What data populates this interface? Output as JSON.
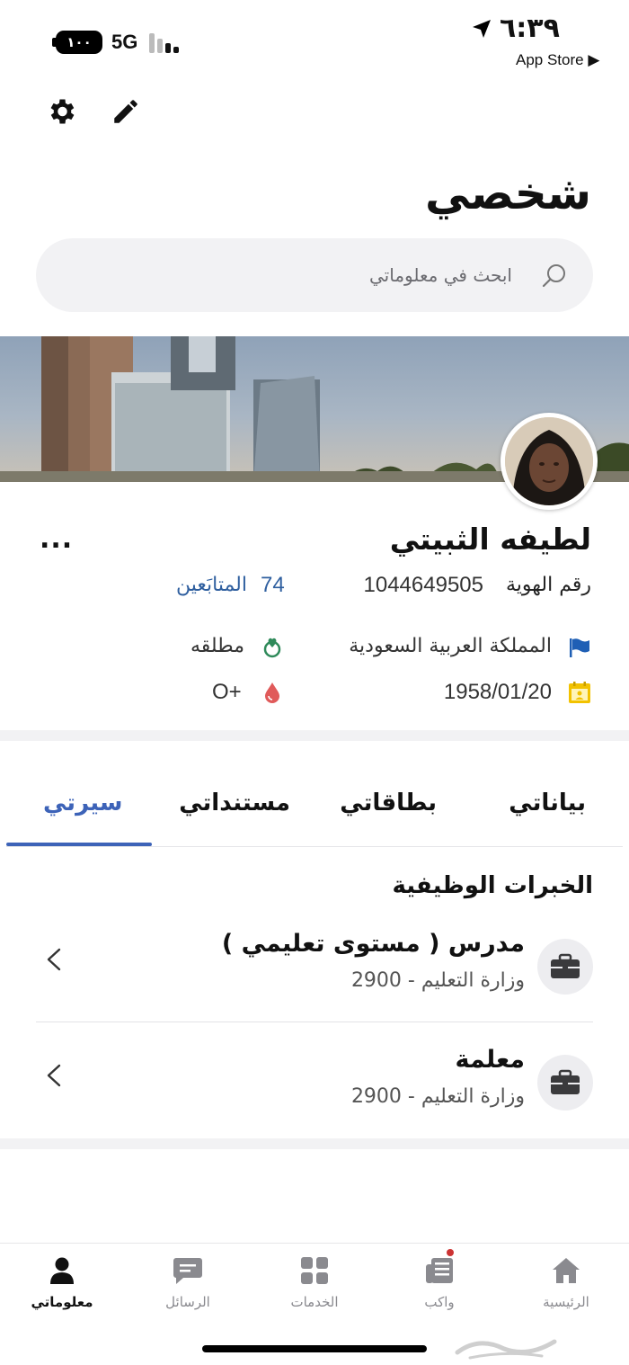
{
  "status_bar": {
    "battery": "١٠٠",
    "network": "5G",
    "time": "٦:٣٩",
    "back_app": "App Store ▶"
  },
  "header": {
    "title": "شخصي",
    "settings_icon": "gear-icon",
    "edit_icon": "pencil-icon"
  },
  "search": {
    "placeholder": "ابحث في معلوماتي"
  },
  "profile": {
    "name": "لطيفه الثبيتي",
    "more": "...",
    "id_label": "رقم الهوية",
    "id_number": "1044649505",
    "followers_count": "74",
    "followers_label": "المتابَعين",
    "nationality": "المملكة العربية السعودية",
    "marital_status": "مطلقه",
    "birth_date": "1958/01/20",
    "blood_type": "O+"
  },
  "tabs": [
    {
      "label": "بياناتي",
      "active": false
    },
    {
      "label": "بطاقاتي",
      "active": false
    },
    {
      "label": "مستنداتي",
      "active": false
    },
    {
      "label": "سيرتي",
      "active": true
    }
  ],
  "experience": {
    "section_title": "الخبرات الوظيفية",
    "items": [
      {
        "title": "مدرس ( مستوى تعليمي )",
        "subtitle": "وزارة التعليم - 2900"
      },
      {
        "title": "معلمة",
        "subtitle": "وزارة التعليم - 2900"
      }
    ]
  },
  "bottom_nav": [
    {
      "label": "الرئيسية",
      "icon": "home-icon",
      "active": false
    },
    {
      "label": "واكب",
      "icon": "news-icon",
      "active": false
    },
    {
      "label": "الخدمات",
      "icon": "grid-icon",
      "active": false
    },
    {
      "label": "الرسائل",
      "icon": "chat-icon",
      "active": false
    },
    {
      "label": "معلوماتي",
      "icon": "person-icon",
      "active": true
    }
  ],
  "colors": {
    "accent": "#3d63b8",
    "followers": "#2f5f9f",
    "flag": "#1f5fb5",
    "heart": "#2f8a5a",
    "blood": "#e05a5a",
    "calendar": "#f2c200"
  }
}
